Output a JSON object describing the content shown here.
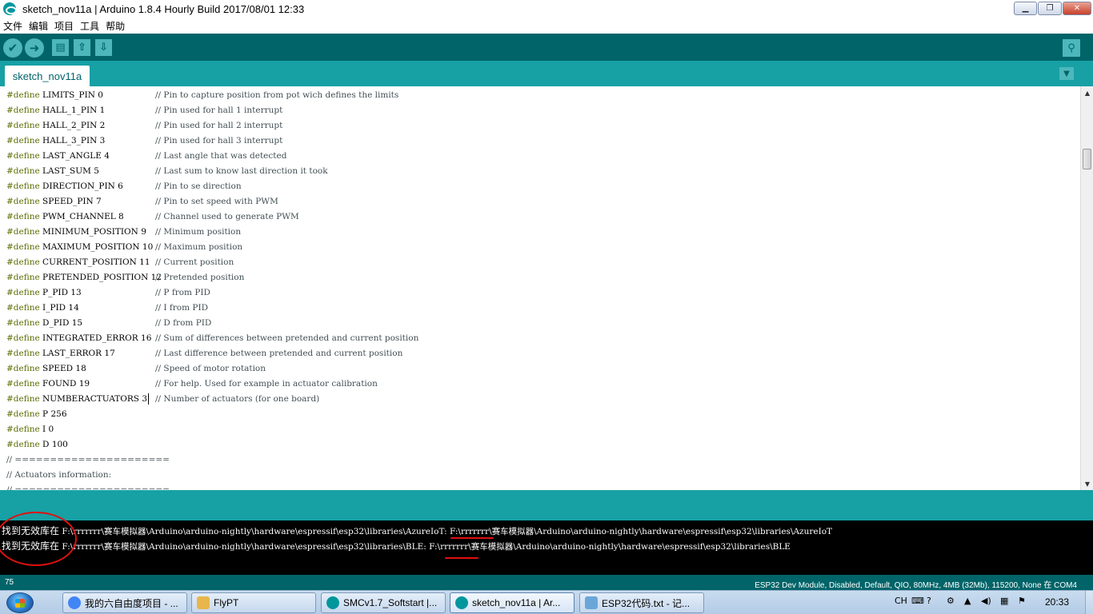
{
  "window": {
    "title": "sketch_nov11a | Arduino 1.8.4 Hourly Build 2017/08/01 12:33",
    "controls": {
      "minimize": "▁",
      "maximize": "❐",
      "close": "✕"
    }
  },
  "menu": [
    "文件",
    "编辑",
    "项目",
    "工具",
    "帮助"
  ],
  "toolbar": {
    "verify_icon": "✔",
    "upload_icon": "➜",
    "new_icon": "▤",
    "open_icon": "⇧",
    "save_icon": "⇩",
    "serial_icon": "⚲"
  },
  "tabs": {
    "active": "sketch_nov11a",
    "menu_icon": "▼"
  },
  "editor": {
    "lines": [
      {
        "kw": "#define",
        "code": " LIMITS_PIN 0",
        "comment": "// Pin to capture position from pot wich defines the limits"
      },
      {
        "kw": "#define",
        "code": " HALL_1_PIN 1",
        "comment": "// Pin used for hall 1 interrupt"
      },
      {
        "kw": "#define",
        "code": " HALL_2_PIN 2",
        "comment": "// Pin used for hall 2 interrupt"
      },
      {
        "kw": "#define",
        "code": " HALL_3_PIN 3",
        "comment": "// Pin used for hall 3 interrupt"
      },
      {
        "kw": "#define",
        "code": " LAST_ANGLE 4",
        "comment": "// Last angle that was detected"
      },
      {
        "kw": "#define",
        "code": " LAST_SUM 5",
        "comment": "// Last sum to know last direction it took"
      },
      {
        "kw": "#define",
        "code": " DIRECTION_PIN 6",
        "comment": "// Pin to se direction"
      },
      {
        "kw": "#define",
        "code": " SPEED_PIN 7",
        "comment": "// Pin to set speed with PWM"
      },
      {
        "kw": "#define",
        "code": " PWM_CHANNEL 8",
        "comment": "// Channel used to generate PWM"
      },
      {
        "kw": "#define",
        "code": " MINIMUM_POSITION 9",
        "comment": "// Minimum position"
      },
      {
        "kw": "#define",
        "code": " MAXIMUM_POSITION 10",
        "comment": "// Maximum position"
      },
      {
        "kw": "#define",
        "code": " CURRENT_POSITION 11",
        "comment": "// Current position"
      },
      {
        "kw": "#define",
        "code": " PRETENDED_POSITION 12",
        "comment": "// Pretended position"
      },
      {
        "kw": "#define",
        "code": " P_PID 13",
        "comment": "// P from PID"
      },
      {
        "kw": "#define",
        "code": " I_PID 14",
        "comment": "// I from PID"
      },
      {
        "kw": "#define",
        "code": " D_PID 15",
        "comment": "// D from PID"
      },
      {
        "kw": "#define",
        "code": " INTEGRATED_ERROR 16",
        "comment": "// Sum of differences between pretended and current position"
      },
      {
        "kw": "#define",
        "code": " LAST_ERROR 17",
        "comment": "// Last difference between pretended and current position"
      },
      {
        "kw": "#define",
        "code": " SPEED 18",
        "comment": "// Speed of motor rotation"
      },
      {
        "kw": "#define",
        "code": " FOUND 19",
        "comment": "// For help. Used for example in actuator calibration"
      },
      {
        "kw": "#define",
        "code": " NUMBERACTUATORS 3",
        "comment": "// Number of actuators (for one board)"
      },
      {
        "kw": "#define",
        "code": " P 256",
        "comment": ""
      },
      {
        "kw": "#define",
        "code": " I 0",
        "comment": ""
      },
      {
        "kw": "#define",
        "code": " D 100",
        "comment": ""
      },
      {
        "kw": "",
        "code": "// ======================",
        "comment": ""
      },
      {
        "kw": "",
        "code": "// Actuators information:",
        "comment": ""
      },
      {
        "kw": "",
        "code": "// ======================",
        "comment": ""
      }
    ]
  },
  "console": {
    "lines": [
      {
        "prefix": "找到无效库在",
        "path": " F:\\rrrrrrr\\赛车模拟器\\Arduino\\arduino-nightly\\hardware\\espressif\\esp32\\libraries\\AzureIoT: F:\\rrrrrrr\\赛车模拟器\\Arduino\\arduino-nightly\\hardware\\espressif\\esp32\\libraries\\AzureIoT"
      },
      {
        "prefix": "找到无效库在",
        "path": " F:\\rrrrrrr\\赛车模拟器\\Arduino\\arduino-nightly\\hardware\\espressif\\esp32\\libraries\\BLE: F:\\rrrrrrr\\赛车模拟器\\Arduino\\arduino-nightly\\hardware\\espressif\\esp32\\libraries\\BLE"
      }
    ],
    "annotation_color": "#e01010"
  },
  "status": {
    "line_number": "75",
    "board": "ESP32 Dev Module, Disabled, Default, QIO, 80MHz, 4MB (32Mb), 115200, None 在 COM4"
  },
  "taskbar": {
    "tasks": [
      {
        "label": "我的六自由度项目 - ...",
        "icon": "chrome-icon",
        "color": "#4285f4"
      },
      {
        "label": "FlyPT",
        "icon": "folder-icon",
        "color": "#e8b64a"
      },
      {
        "label": "SMCv1.7_Softstart |...",
        "icon": "arduino-icon",
        "color": "#00979c"
      },
      {
        "label": "sketch_nov11a | Ar...",
        "icon": "arduino-icon",
        "color": "#00979c"
      },
      {
        "label": "ESP32代码.txt - 记...",
        "icon": "notepad-icon",
        "color": "#6aa7d8"
      }
    ],
    "tray": {
      "ime": "CH",
      "clock": "20:33"
    }
  }
}
